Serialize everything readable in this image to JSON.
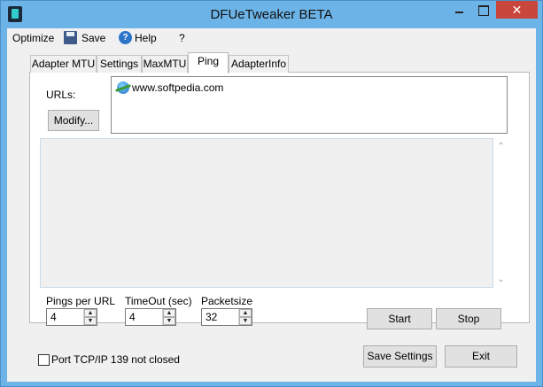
{
  "window": {
    "title": "DFUeTweaker BETA",
    "close_glyph": "✕"
  },
  "menu": {
    "optimize": "Optimize",
    "save": "Save",
    "help": "Help",
    "question": "?"
  },
  "tabs": [
    {
      "label": "Adapter MTU",
      "active": false
    },
    {
      "label": "Settings",
      "active": false
    },
    {
      "label": "MaxMTU",
      "active": false
    },
    {
      "label": "Ping",
      "active": true
    },
    {
      "label": "AdapterInfo",
      "active": false
    }
  ],
  "ping": {
    "urls_label": "URLs:",
    "modify_button": "Modify...",
    "urls": [
      "www.softpedia.com"
    ],
    "pings_per_url_label": "Pings per URL",
    "pings_per_url_value": "4",
    "timeout_label": "TimeOut (sec)",
    "timeout_value": "4",
    "packetsize_label": "Packetsize",
    "packetsize_value": "32",
    "start_button": "Start",
    "stop_button": "Stop"
  },
  "footer": {
    "port_checkbox_label": "Port TCP/IP 139 not closed",
    "port_checked": false,
    "save_settings_button": "Save Settings",
    "exit_button": "Exit"
  },
  "colors": {
    "title_bar": "#6cb4e8",
    "close_button": "#c9463d",
    "panel_background": "#f0f0f0"
  }
}
